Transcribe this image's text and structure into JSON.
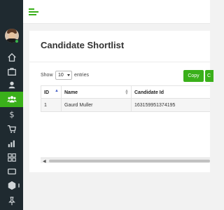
{
  "sidebar": {
    "items": [
      {
        "icon": "home-icon"
      },
      {
        "icon": "briefcase-icon"
      },
      {
        "icon": "user-icon"
      },
      {
        "icon": "users-icon",
        "active": true
      },
      {
        "icon": "dollar-icon"
      },
      {
        "icon": "cart-icon"
      },
      {
        "icon": "bar-chart-icon"
      },
      {
        "icon": "grid-icon"
      },
      {
        "icon": "monitor-icon"
      },
      {
        "icon": "hexagon-icon"
      },
      {
        "icon": "pin-icon"
      }
    ]
  },
  "colors": {
    "accent": "#3ab01a",
    "sidebar_bg": "#1f2a30"
  },
  "card": {
    "title": "Candidate Shortlist",
    "show_label": "Show",
    "entries_value": "10",
    "entries_label": "entries",
    "buttons": {
      "copy": "Copy",
      "next_partial": "C"
    }
  },
  "table": {
    "columns": [
      "ID",
      "Name",
      "Candidate Id"
    ],
    "rows": [
      [
        "1",
        "Gaurd Muller",
        "163159951374195"
      ]
    ]
  }
}
